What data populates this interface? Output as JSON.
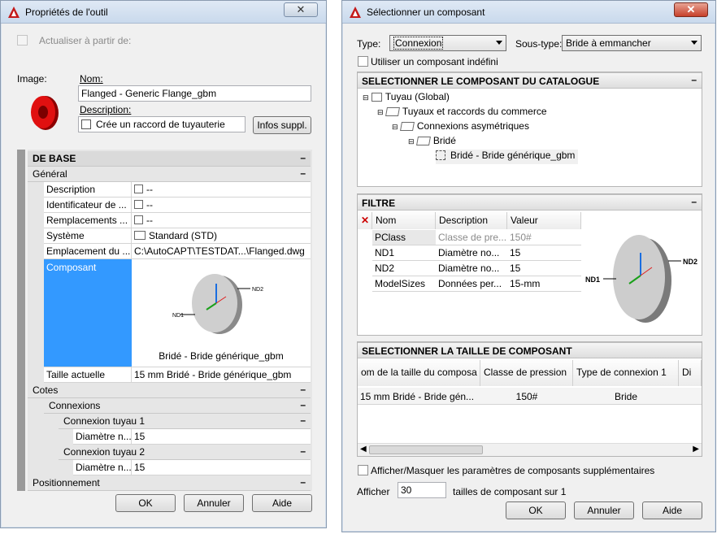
{
  "left_dialog": {
    "title": "Propriétés de l'outil",
    "update_checkbox_label": "Actualiser à partir de:",
    "image_label": "Image:",
    "name_label": "Nom:",
    "name_value": "Flanged - Generic Flange_gbm",
    "description_label": "Description:",
    "description_value": "Crée un raccord de tuyauterie",
    "more_info_button": "Infos suppl.",
    "groups": {
      "base": "DE BASE",
      "general": "Général",
      "cotes": "Cotes",
      "connexions": "Connexions",
      "connexion1": "Connexion tuyau 1",
      "connexion2": "Connexion tuyau 2",
      "positionnement": "Positionnement"
    },
    "properties": [
      {
        "name": "Description",
        "value": "--"
      },
      {
        "name": "Identificateur de ...",
        "value": "--"
      },
      {
        "name": "Remplacements ...",
        "value": "--"
      },
      {
        "name": "Système",
        "value": "Standard (STD)"
      },
      {
        "name": "Emplacement du ...",
        "value": "C:\\AutoCAPT\\TESTDAT...\\Flanged.dwg"
      }
    ],
    "composant_label": "Composant",
    "composant_caption": "Bridé - Bride générique_gbm",
    "preview_nd1": "ND1",
    "preview_nd2": "ND2",
    "taille_label": "Taille actuelle",
    "taille_value": "15 mm Bridé - Bride générique_gbm",
    "diam1_label": "Diamètre n...",
    "diam1_value": "15",
    "diam2_label": "Diamètre n...",
    "diam2_value": "15",
    "ok": "OK",
    "cancel": "Annuler",
    "help": "Aide"
  },
  "right_dialog": {
    "title": "Sélectionner un composant",
    "type_label": "Type:",
    "type_value": "Connexion",
    "subtype_label": "Sous-type:",
    "subtype_value": "Bride à emmancher",
    "undefined_checkbox": "Utiliser un composant indéfini",
    "catalog_header": "SELECTIONNER LE COMPOSANT DU CATALOGUE",
    "tree": [
      "Tuyau (Global)",
      "Tuyaux et raccords du commerce",
      "Connexions asymétriques",
      "Bridé",
      "Bridé - Bride générique_gbm"
    ],
    "filter_header": "FILTRE",
    "filter_columns": [
      "Nom",
      "Description",
      "Valeur"
    ],
    "filter_rows": [
      {
        "nom": "PClass",
        "desc": "Classe de pre...",
        "val": "150#"
      },
      {
        "nom": "ND1",
        "desc": "Diamètre no...",
        "val": "15"
      },
      {
        "nom": "ND2",
        "desc": "Diamètre no...",
        "val": "15"
      },
      {
        "nom": "ModelSizes",
        "desc": "Données per...",
        "val": "15-mm"
      }
    ],
    "preview_nd1": "ND1",
    "preview_nd2": "ND2",
    "size_header": "SELECTIONNER LA TAILLE DE COMPOSANT",
    "size_columns": [
      "om de la taille du composa",
      "Classe de pression",
      "Type de connexion 1",
      "Di"
    ],
    "size_rows": [
      {
        "name": "15 mm Bridé - Bride gén...",
        "pressure": "150#",
        "conn": "Bride"
      }
    ],
    "show_hide_label": "Afficher/Masquer les paramètres de composants supplémentaires",
    "display_label": "Afficher",
    "display_value": "30",
    "display_suffix": "tailles de composant sur 1",
    "ok": "OK",
    "cancel": "Annuler",
    "help": "Aide"
  },
  "colors": {
    "selection_blue": "#3399ff",
    "title_grad_top": "#dfe9f5",
    "close_red": "#c7402b"
  }
}
